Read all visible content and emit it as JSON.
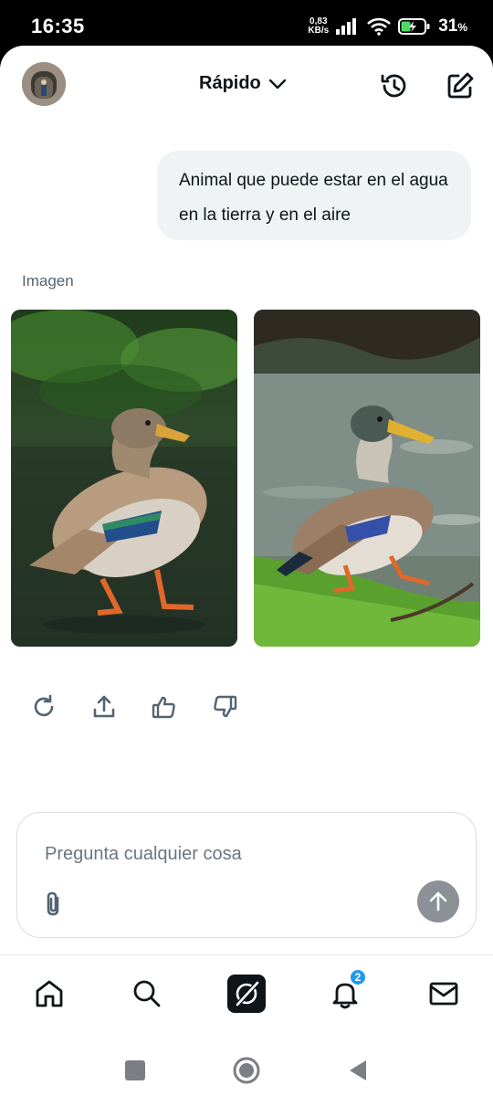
{
  "status_bar": {
    "time": "16:35",
    "net_speed_value": "0,83",
    "net_speed_unit": "KB/s",
    "battery_percent": "31",
    "battery_unit": "%"
  },
  "header": {
    "model_label": "Rápido",
    "avatar_icon": "user-avatar",
    "history_icon": "history-icon",
    "new_chat_icon": "edit-icon"
  },
  "conversation": {
    "user_message": "Animal que puede estar en el agua en la tierra y en el aire",
    "response_label": "Imagen",
    "images": [
      {
        "icon": "mallard-duck-image-1"
      },
      {
        "icon": "mallard-duck-image-2"
      }
    ],
    "actions": [
      {
        "icon": "regenerate-icon"
      },
      {
        "icon": "share-icon"
      },
      {
        "icon": "thumbs-up-icon"
      },
      {
        "icon": "thumbs-down-icon"
      }
    ]
  },
  "composer": {
    "placeholder": "Pregunta cualquier cosa",
    "value": ""
  },
  "bottom_nav": {
    "items": [
      {
        "icon": "home-icon"
      },
      {
        "icon": "search-icon"
      },
      {
        "icon": "grok-icon"
      },
      {
        "icon": "notifications-icon",
        "badge": "2"
      },
      {
        "icon": "mail-icon"
      }
    ]
  },
  "colors": {
    "accent_badge": "#1d9bf0",
    "send_button": "#8b9197",
    "bubble_bg": "#eff3f4"
  }
}
